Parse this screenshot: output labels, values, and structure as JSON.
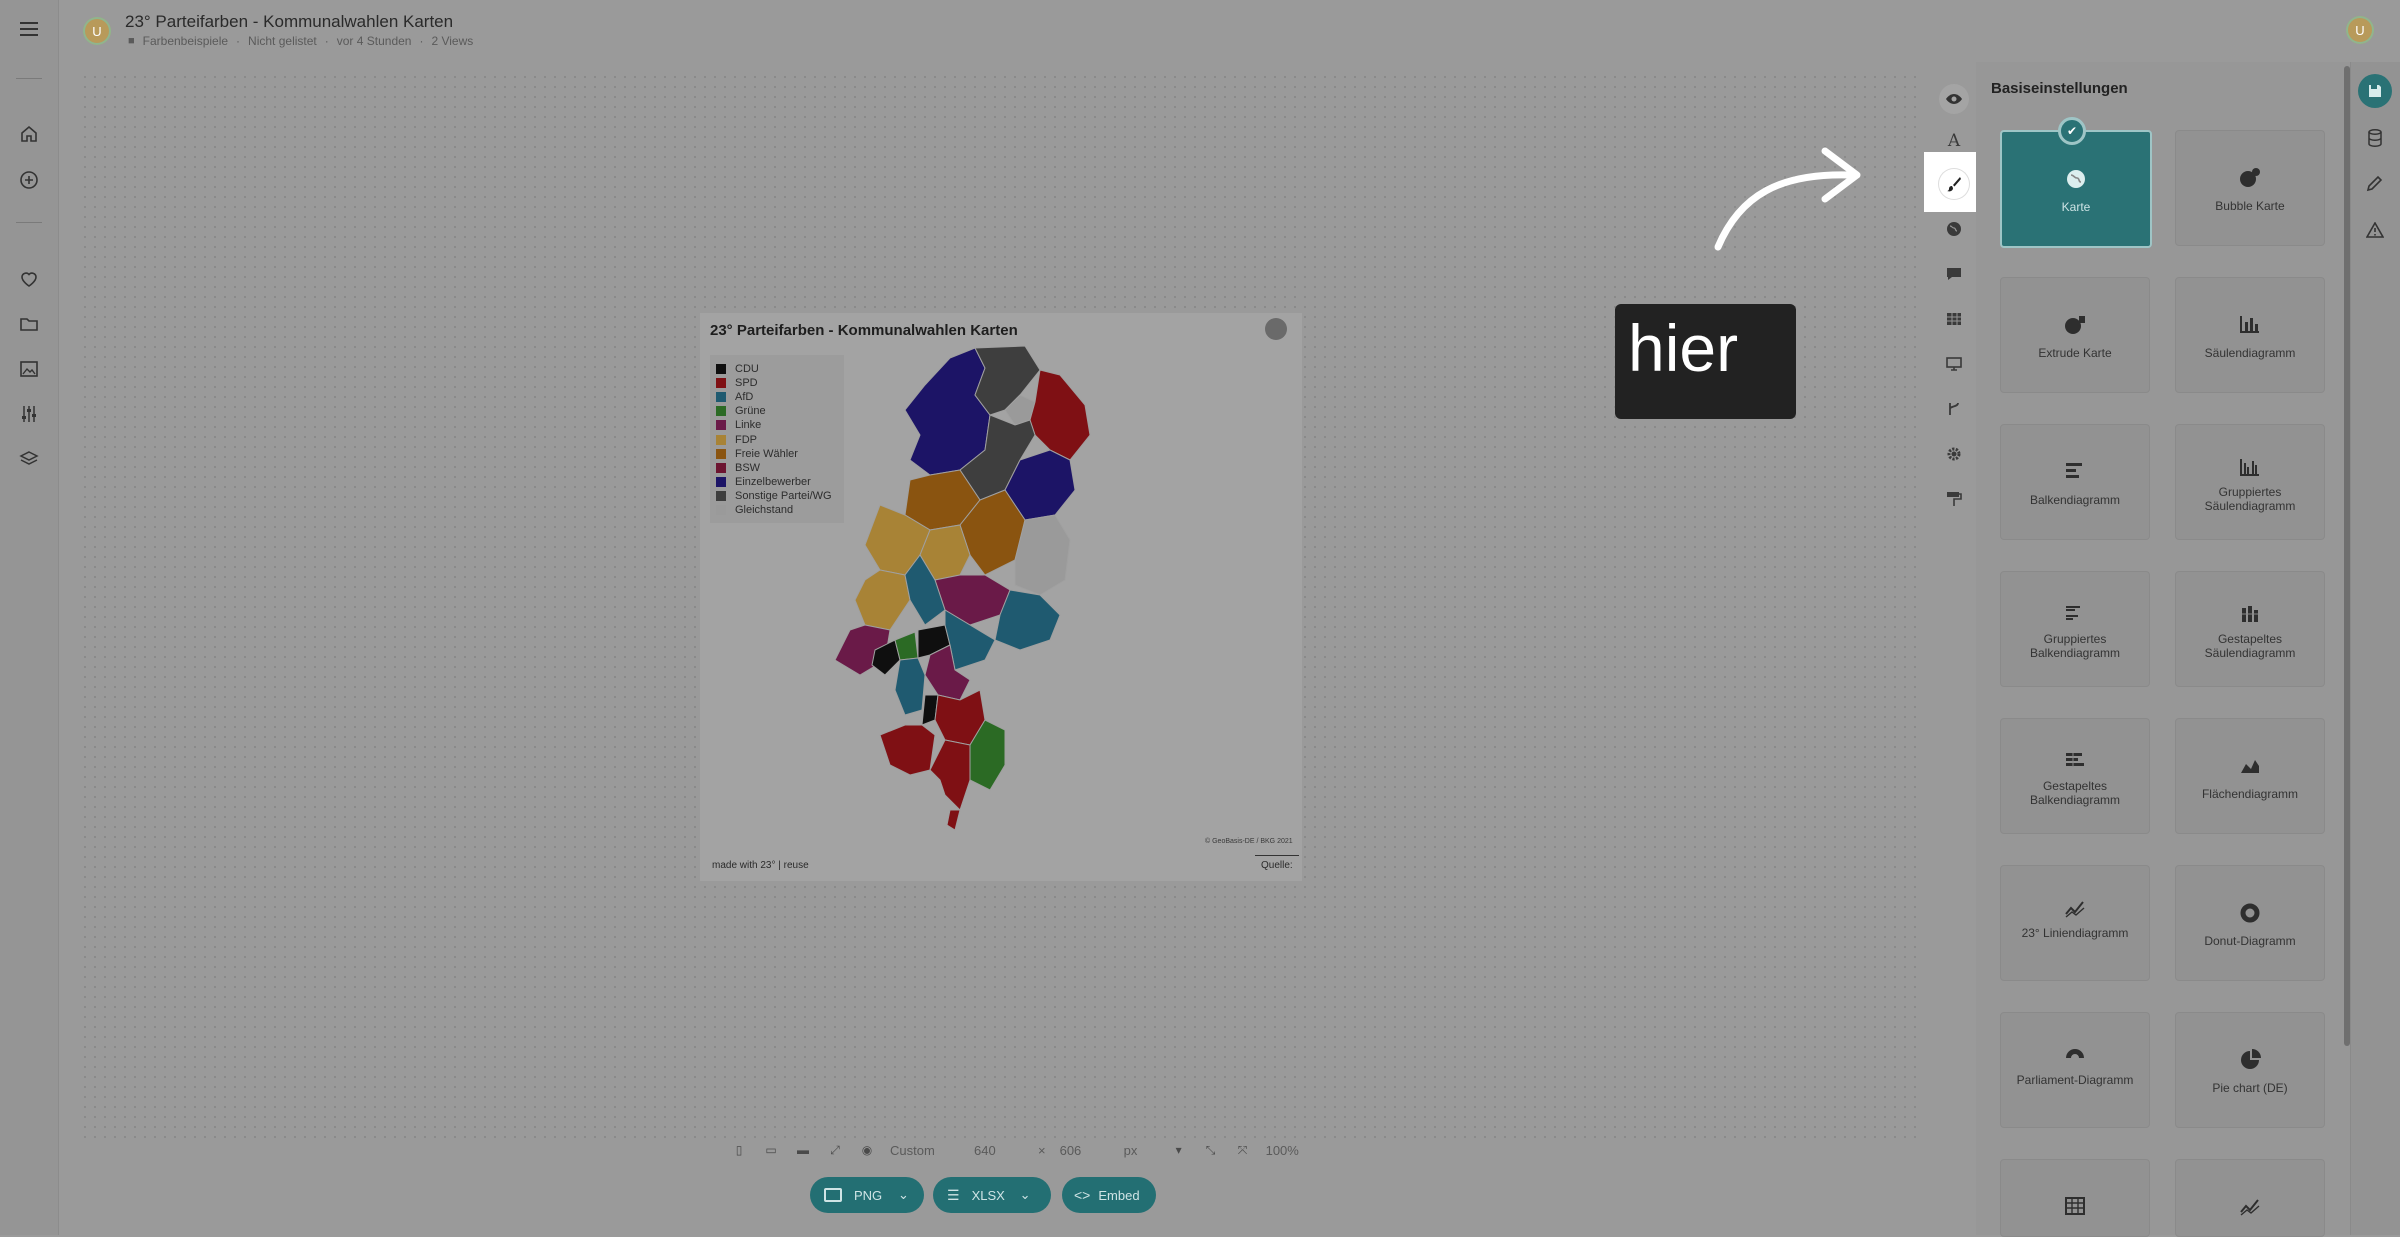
{
  "header": {
    "avatar_letter": "U",
    "title": "23° Parteifarben - Kommunalwahlen Karten",
    "meta": {
      "folder": "Farbenbeispiele",
      "listing": "Nicht gelistet",
      "time": "vor 4 Stunden",
      "views": "2 Views"
    },
    "user_avatar_letter": "U"
  },
  "left_nav": [
    "menu-icon",
    "home-icon",
    "add-circle-icon",
    "heart-icon",
    "folder-icon",
    "image-icon",
    "sliders-icon",
    "layers-icon"
  ],
  "chart_data": {
    "type": "map",
    "title": "23° Parteifarben - Kommunalwahlen Karten",
    "legend": [
      {
        "label": "CDU",
        "color": "#0f0f0f"
      },
      {
        "label": "SPD",
        "color": "#7f1014"
      },
      {
        "label": "AfD",
        "color": "#1f5a70"
      },
      {
        "label": "Grüne",
        "color": "#2b6a24"
      },
      {
        "label": "Linke",
        "color": "#6a1a48"
      },
      {
        "label": "FDP",
        "color": "#a88336"
      },
      {
        "label": "Freie Wähler",
        "color": "#8a5410"
      },
      {
        "label": "BSW",
        "color": "#6c1430"
      },
      {
        "label": "Einzelbewerber",
        "color": "#1c1466"
      },
      {
        "label": "Sonstige Partei/WG",
        "color": "#3e3e3e"
      },
      {
        "label": "Gleichstand",
        "color": "#9a9a9a"
      }
    ],
    "footer_left": "made with 23° | reuse",
    "footer_right": "Quelle:",
    "credit": "© GeoBasis-DE / BKG 2021"
  },
  "size_bar": {
    "preset": "Custom",
    "width": "640",
    "times": "×",
    "height": "606",
    "unit": "px",
    "zoom": "100%"
  },
  "export_buttons": {
    "png": "PNG",
    "xlsx": "XLSX",
    "embed": "Embed"
  },
  "tools": [
    "eye-icon",
    "text-icon",
    "brush-icon",
    "globe-icon",
    "comment-icon",
    "table-icon",
    "monitor-icon",
    "branch-icon",
    "gear-icon",
    "paint-roller-icon"
  ],
  "annotation": {
    "text": "hier"
  },
  "panel": {
    "title": "Basiseinstellungen",
    "tiles": [
      {
        "label": "Karte",
        "icon": "globe-icon",
        "selected": true
      },
      {
        "label": "Bubble Karte",
        "icon": "bubble-globe-icon"
      },
      {
        "label": "Extrude Karte",
        "icon": "extrude-globe-icon"
      },
      {
        "label": "Säulendiagramm",
        "icon": "column-chart-icon"
      },
      {
        "label": "Balkendiagramm",
        "icon": "bar-chart-icon"
      },
      {
        "label": "Gruppiertes Säulendiagramm",
        "icon": "grouped-column-icon"
      },
      {
        "label": "Gruppiertes Balkendiagramm",
        "icon": "grouped-bar-icon"
      },
      {
        "label": "Gestapeltes Säulendiagramm",
        "icon": "stacked-column-icon"
      },
      {
        "label": "Gestapeltes Balkendiagramm",
        "icon": "stacked-bar-icon"
      },
      {
        "label": "Flächendiagramm",
        "icon": "area-chart-icon"
      },
      {
        "label": "23° Liniendiagramm",
        "icon": "line-chart-icon"
      },
      {
        "label": "Donut-Diagramm",
        "icon": "donut-icon"
      },
      {
        "label": "Parliament-Diagramm",
        "icon": "parliament-icon"
      },
      {
        "label": "Pie chart (DE)",
        "icon": "pie-icon"
      },
      {
        "label": "",
        "icon": "table-icon"
      },
      {
        "label": "",
        "icon": "line-chart-icon"
      }
    ]
  },
  "right_strip": [
    "save-icon",
    "database-icon",
    "pencil-icon",
    "warning-icon"
  ]
}
